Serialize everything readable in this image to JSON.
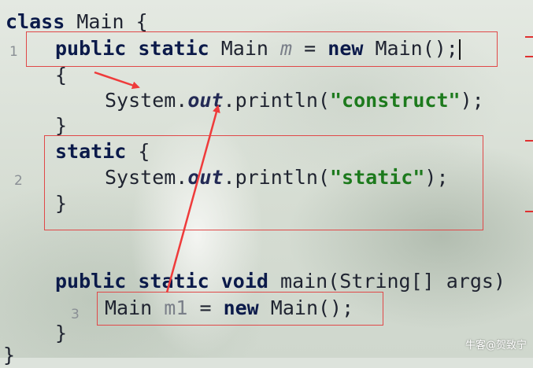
{
  "code": {
    "line1": {
      "kw": "class",
      "rest": " Main {"
    },
    "line2": {
      "kw1": "public",
      "kw2": "static",
      "type": "Main",
      "var": "m",
      "eq": "=",
      "kw3": "new",
      "call": "Main();"
    },
    "line3": {
      "brace": "{"
    },
    "line4": {
      "cls": "System.",
      "field": "out",
      "call": ".println(",
      "str": "\"construct\"",
      "end": ");"
    },
    "line5": {
      "brace": "}"
    },
    "line6": {
      "kw": "static",
      "brace": "{"
    },
    "line7": {
      "cls": "System.",
      "field": "out",
      "call": ".println(",
      "str": "\"static\"",
      "end": ");"
    },
    "line8": {
      "brace": "}"
    },
    "line9": {
      "kw1": "public",
      "kw2": "static",
      "kw3": "void",
      "rest": "main(String[] args)"
    },
    "line10": {
      "type": "Main",
      "var": "m1",
      "eq": "=",
      "kw": "new",
      "call": "Main();"
    },
    "line11": {
      "brace": "}"
    },
    "line12": {
      "brace": "}"
    }
  },
  "annotations": {
    "num1": "1",
    "num2": "2",
    "num3": "3"
  },
  "watermark": "牛客@贺致宁",
  "colors": {
    "keyword": "#0b1a4a",
    "string": "#1d7a1d",
    "annotation_red": "#e04848"
  }
}
